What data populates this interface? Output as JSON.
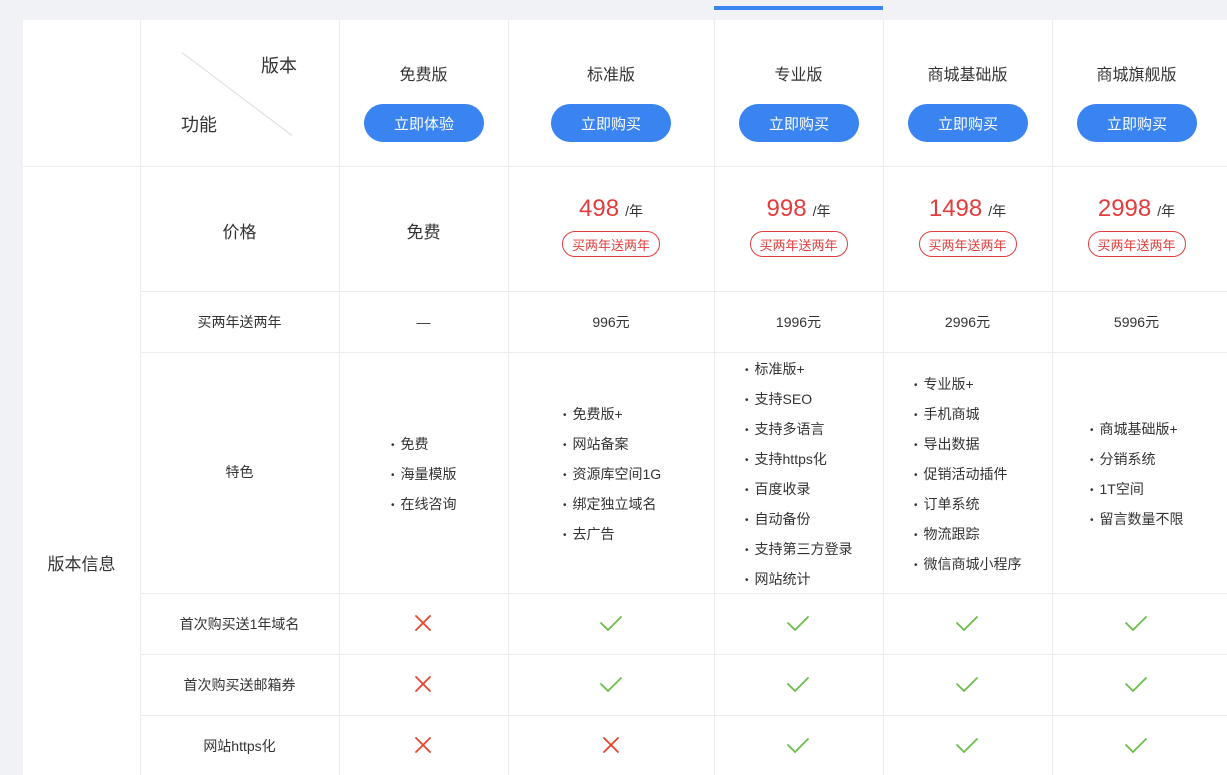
{
  "header": {
    "version_label": "版本",
    "function_label": "功能"
  },
  "plans": [
    {
      "name": "免费版",
      "button": "立即体验"
    },
    {
      "name": "标准版",
      "button": "立即购买"
    },
    {
      "name": "专业版",
      "button": "立即购买"
    },
    {
      "name": "商城基础版",
      "button": "立即购买"
    },
    {
      "name": "商城旗舰版",
      "button": "立即购买"
    }
  ],
  "section_label": "版本信息",
  "rows": {
    "price": {
      "label": "价格",
      "free_text": "免费",
      "unit": "/年",
      "promo": "买两年送两年",
      "values": [
        "498",
        "998",
        "1498",
        "2998"
      ]
    },
    "two_years": {
      "label": "买两年送两年",
      "values": [
        "—",
        "996元",
        "1996元",
        "2996元",
        "5996元"
      ]
    },
    "features": {
      "label": "特色",
      "lists": [
        [
          "免费",
          "海量模版",
          "在线咨询"
        ],
        [
          "免费版+",
          "网站备案",
          "资源库空间1G",
          "绑定独立域名",
          "去广告"
        ],
        [
          "标准版+",
          "支持SEO",
          "支持多语言",
          "支持https化",
          "百度收录",
          "自动备份",
          "支持第三方登录",
          "网站统计"
        ],
        [
          "专业版+",
          "手机商城",
          "导出数据",
          "促销活动插件",
          "订单系统",
          "物流跟踪",
          "微信商城小程序"
        ],
        [
          "商城基础版+",
          "分销系统",
          "1T空间",
          "留言数量不限"
        ]
      ]
    },
    "checks": [
      {
        "label": "首次购买送1年域名",
        "values": [
          "cross-icon",
          "check-icon",
          "check-icon",
          "check-icon",
          "check-icon"
        ]
      },
      {
        "label": "首次购买送邮箱券",
        "values": [
          "cross-icon",
          "check-icon",
          "check-icon",
          "check-icon",
          "check-icon"
        ]
      },
      {
        "label": "网站https化",
        "values": [
          "cross-icon",
          "cross-icon",
          "check-icon",
          "check-icon",
          "check-icon"
        ]
      }
    ]
  },
  "colors": {
    "accent": "#3a84f1",
    "price": "#e23c3c",
    "check": "#6abf4b",
    "cross": "#e8442c"
  }
}
